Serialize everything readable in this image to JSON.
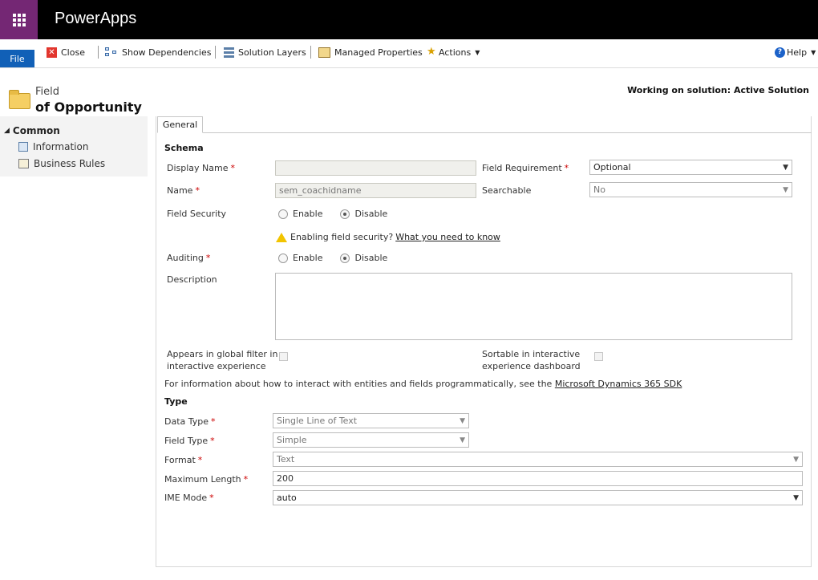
{
  "app": {
    "name": "PowerApps"
  },
  "ribbon": {
    "file": "File",
    "close": "Close",
    "show_dependencies": "Show Dependencies",
    "solution_layers": "Solution Layers",
    "managed_properties": "Managed Properties",
    "actions": "Actions",
    "help": "Help"
  },
  "header": {
    "entity_type": "Field",
    "entity_name": "of Opportunity",
    "solution": "Working on solution: Active Solution"
  },
  "nav": {
    "group": "Common",
    "items": [
      {
        "label": "Information"
      },
      {
        "label": "Business Rules"
      }
    ]
  },
  "tabs": [
    {
      "label": "General"
    }
  ],
  "schema": {
    "title": "Schema",
    "display_name": {
      "label": "Display Name",
      "value": ""
    },
    "name": {
      "label": "Name",
      "value": "sem_coachidname"
    },
    "field_requirement": {
      "label": "Field Requirement",
      "value": "Optional"
    },
    "searchable": {
      "label": "Searchable",
      "value": "No"
    },
    "field_security": {
      "label": "Field Security",
      "enable": "Enable",
      "disable": "Disable",
      "selected": "Disable"
    },
    "warning": {
      "text": "Enabling field security?",
      "link": "What you need to know"
    },
    "auditing": {
      "label": "Auditing",
      "enable": "Enable",
      "disable": "Disable",
      "selected": "Disable"
    },
    "description": {
      "label": "Description",
      "value": ""
    },
    "global_filter": {
      "label_line1": "Appears in global filter in",
      "label_line2": "interactive experience",
      "checked": false
    },
    "sortable": {
      "label_line1": "Sortable in interactive",
      "label_line2": "experience dashboard",
      "checked": false
    },
    "sdk_info": {
      "text": "For information about how to interact with entities and fields programmatically, see the",
      "link": "Microsoft Dynamics 365 SDK"
    }
  },
  "type": {
    "title": "Type",
    "data_type": {
      "label": "Data Type",
      "value": "Single Line of Text"
    },
    "field_type": {
      "label": "Field Type",
      "value": "Simple"
    },
    "format": {
      "label": "Format",
      "value": "Text"
    },
    "max_length": {
      "label": "Maximum Length",
      "value": "200"
    },
    "ime_mode": {
      "label": "IME Mode",
      "value": "auto"
    }
  },
  "colors": {
    "brand": "#742774",
    "file_button": "#1160b7",
    "required": "#cc0000"
  }
}
